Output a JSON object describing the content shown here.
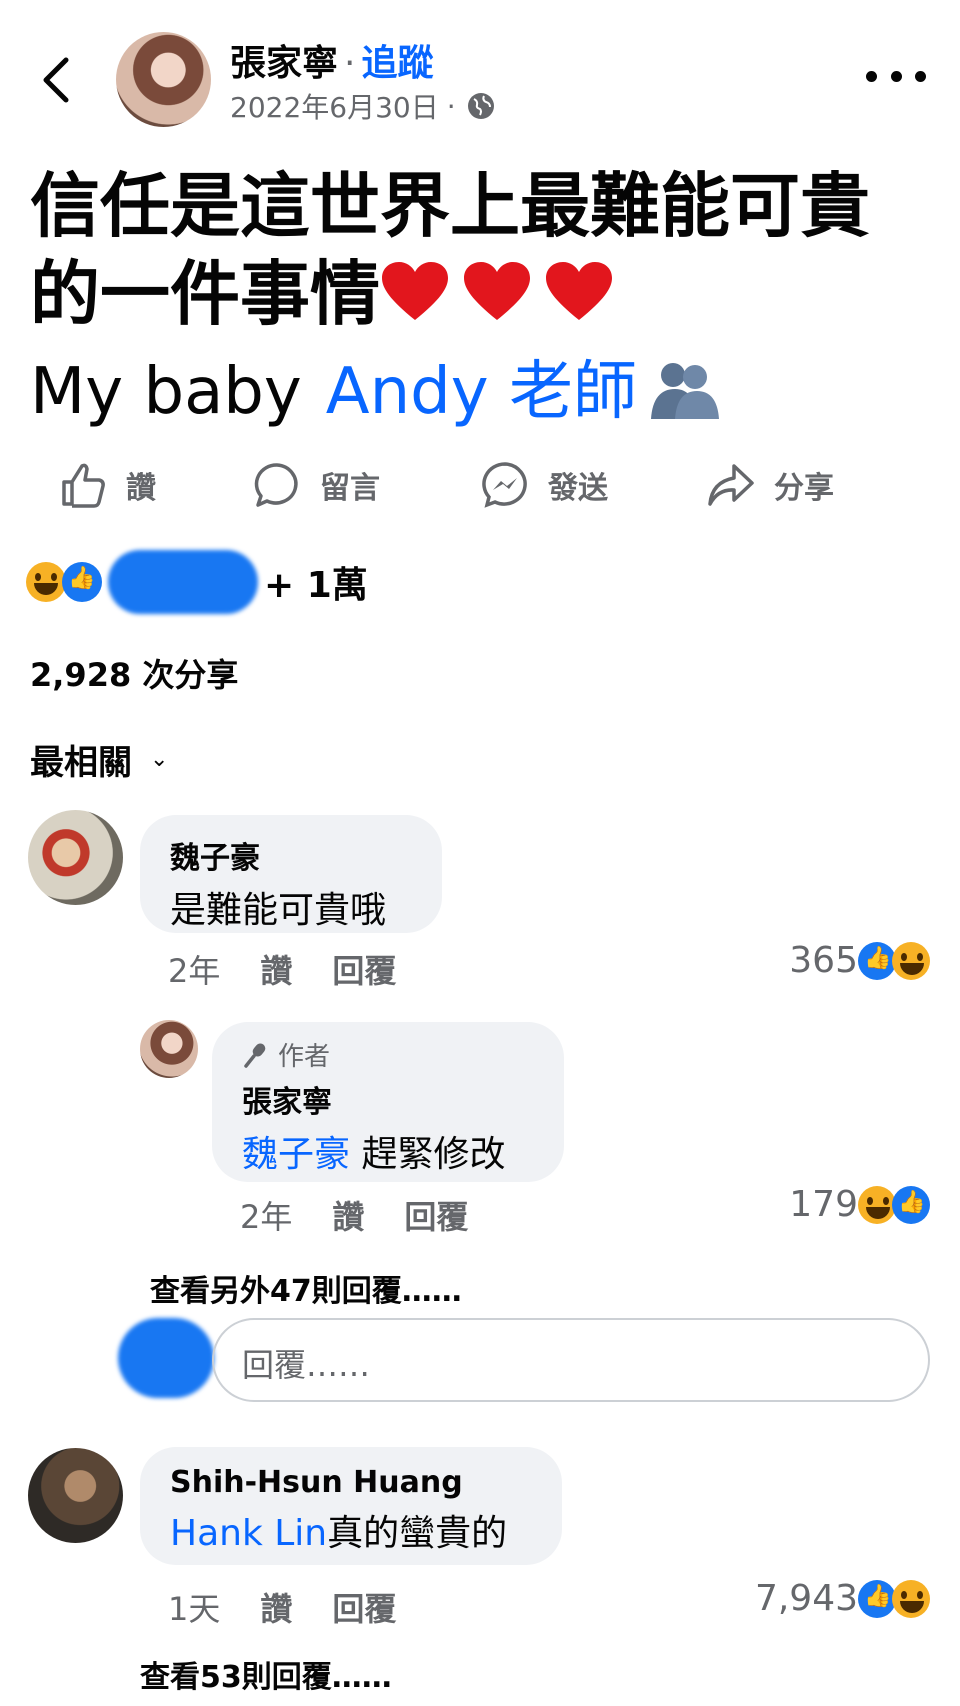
{
  "header": {
    "author": "張家寧",
    "separator": "·",
    "follow": "追蹤",
    "date": "2022年6月30日",
    "date_dot": "·",
    "privacy_icon": "globe-icon"
  },
  "post": {
    "line1": "信任是這世界上最難能可貴",
    "line2": "的一件事情",
    "line3_text": "My baby",
    "line3_mention": "Andy 老師"
  },
  "actions": [
    {
      "label": "讚",
      "icon": "like-icon"
    },
    {
      "label": "留言",
      "icon": "comment-icon"
    },
    {
      "label": "發送",
      "icon": "messenger-icon"
    },
    {
      "label": "分享",
      "icon": "share-icon"
    }
  ],
  "reactions": {
    "count": "+ 1萬"
  },
  "shares": "2,928 次分享",
  "sort": {
    "label": "最相關"
  },
  "comments": [
    {
      "name": "魏子豪",
      "text": "是難能可貴哦",
      "time": "2年",
      "like": "讚",
      "reply": "回覆",
      "count": "365"
    },
    {
      "author_tag": "作者",
      "name": "張家寧",
      "mention": "魏子豪",
      "text": " 趕緊修改",
      "time": "2年",
      "like": "讚",
      "reply": "回覆",
      "count": "179"
    },
    {
      "name": "Shih-Hsun Huang",
      "mention": "Hank Lin",
      "text": "真的蠻貴的",
      "time": "1天",
      "like": "讚",
      "reply": "回覆",
      "count": "7,943"
    }
  ],
  "view_more_1": "查看另外47則回覆……",
  "reply_placeholder": "回覆……",
  "view_more_2": "查看53則回覆……",
  "colors": {
    "accent": "#0866ff",
    "muted": "#65676b",
    "bubble": "#f0f2f5"
  }
}
